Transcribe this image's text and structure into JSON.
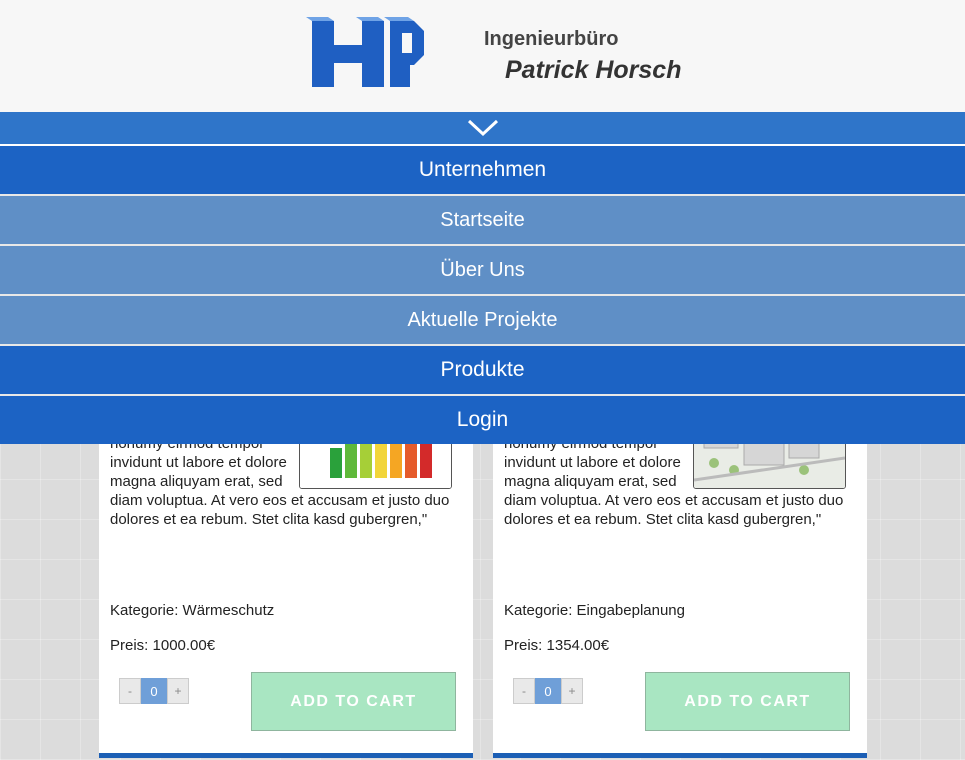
{
  "header": {
    "company_line1": "Ingenieurbüro",
    "company_line2": "Patrick Horsch",
    "logo_text": "HP"
  },
  "menu": {
    "toggle_icon": "chevron-down-icon",
    "items": [
      {
        "label": "Unternehmen",
        "style": "dark"
      },
      {
        "label": "Startseite",
        "style": "light"
      },
      {
        "label": "Über Uns",
        "style": "light"
      },
      {
        "label": "Aktuelle Projekte",
        "style": "light"
      },
      {
        "label": "Produkte",
        "style": "dark"
      },
      {
        "label": "Login",
        "style": "dark"
      }
    ]
  },
  "products": [
    {
      "description": "amet, consetetur sadipscing elitr, sed diam nonumy eirmod tempor invidunt ut labore et dolore magna aliquyam erat, sed diam voluptua. At vero eos et accusam et justo duo dolores et ea rebum. Stet clita kasd gubergren,\"",
      "category": "Kategorie: Wärmeschutz",
      "price": "Preis: 1000.00€",
      "qty": "0",
      "minus": "-",
      "plus": "+",
      "cart_label": "ADD TO CART"
    },
    {
      "description": "amet, consetetur sadipscing elitr, sed diam nonumy eirmod tempor invidunt ut labore et dolore magna aliquyam erat, sed diam voluptua. At vero eos et accusam et justo duo dolores et ea rebum. Stet clita kasd gubergren,\"",
      "category": "Kategorie: Eingabeplanung",
      "price": "Preis: 1354.00€",
      "qty": "0",
      "minus": "-",
      "plus": "+",
      "cart_label": "ADD TO CART"
    }
  ],
  "colors": {
    "menu_dark": "#1c63c4",
    "menu_light": "#5f8fc6",
    "cart_button": "#a9e6c2",
    "accent": "#1c5fb5"
  }
}
